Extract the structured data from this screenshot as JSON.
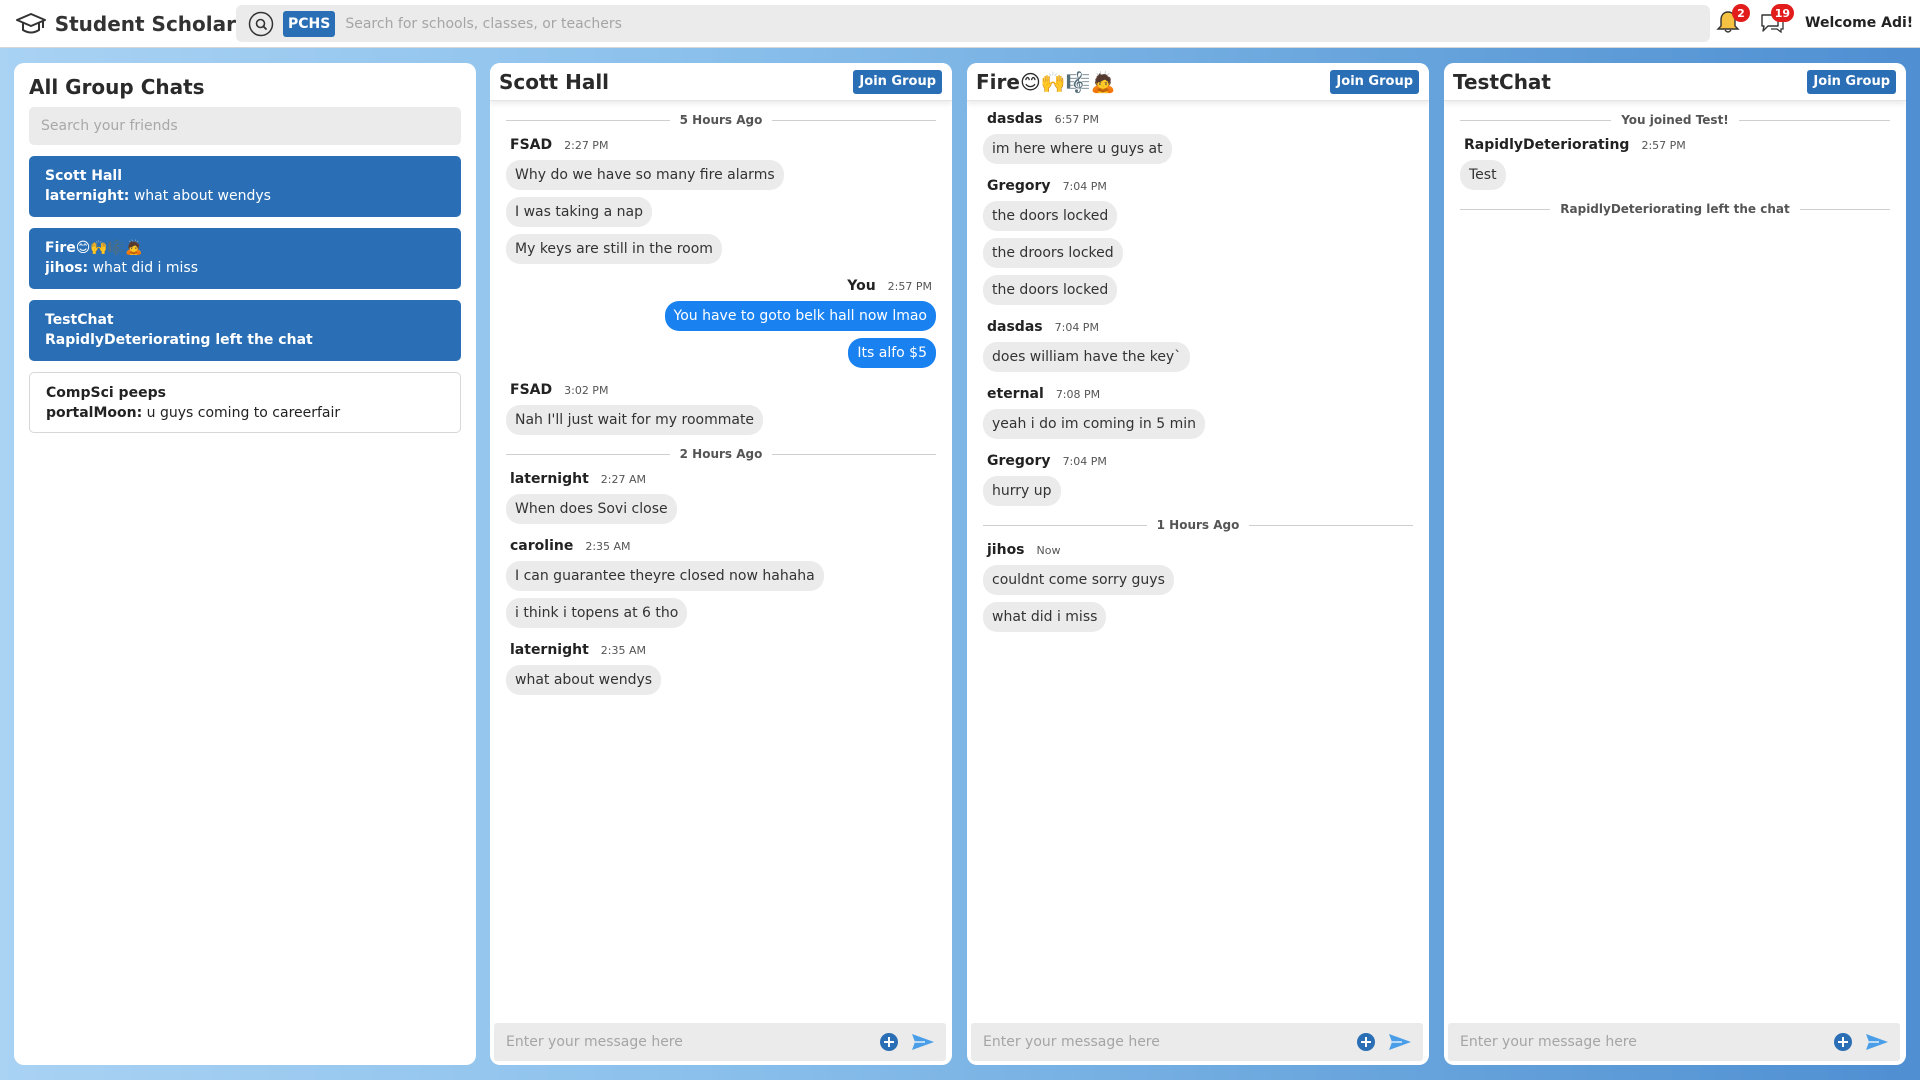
{
  "app": {
    "name": "Student Scholar",
    "search_placeholder": "Search for schools, classes, or teachers",
    "school_badge": "PCHS",
    "notifications_count": "2",
    "messages_count": "19",
    "welcome": "Welcome Adi!"
  },
  "sidebar": {
    "title": "All Group Chats",
    "search_placeholder": "Search your friends",
    "chats": [
      {
        "title": "Scott Hall",
        "sender": "laternight:",
        "preview": " what about wendys",
        "active": true
      },
      {
        "title": "Fire😊🙌🎼🙇",
        "sender": "jihos:",
        "preview": " what did i miss",
        "active": true
      },
      {
        "title": "TestChat",
        "sender": "",
        "preview": "RapidlyDeteriorating left the chat",
        "active": true
      },
      {
        "title": "CompSci peeps",
        "sender": "portalMoon:",
        "preview": " u guys coming to careerfair",
        "active": false
      }
    ]
  },
  "panels": {
    "scott": {
      "title": "Scott Hall",
      "join": "Join Group",
      "composer": "Enter your message here",
      "div1": "5 Hours Ago",
      "div2": "2 Hours Ago",
      "m1_sender": "FSAD",
      "m1_time": "2:27 PM",
      "m1_b1": "Why do we have so many fire alarms",
      "m1_b2": "I was taking a nap",
      "m1_b3": "My keys are still in the room",
      "m2_sender": "You",
      "m2_time": "2:57 PM",
      "m2_b1": "You have to goto belk hall now lmao",
      "m2_b2": "Its alfo $5",
      "m3_sender": "FSAD",
      "m3_time": "3:02 PM",
      "m3_b1": "Nah I'll just wait for my roommate",
      "m4_sender": "laternight",
      "m4_time": "2:27 AM",
      "m4_b1": "When does Sovi close",
      "m5_sender": "caroline",
      "m5_time": "2:35 AM",
      "m5_b1": "I can guarantee theyre closed now hahaha",
      "m5_b2": "i think i topens at 6 tho",
      "m6_sender": "laternight",
      "m6_time": "2:35 AM",
      "m6_b1": "what about wendys"
    },
    "fire": {
      "title": "Fire😊🙌🎼🙇",
      "join": "Join Group",
      "composer": "Enter your message here",
      "div1": "1 Hours Ago",
      "m1_sender": "dasdas",
      "m1_time": "6:57 PM",
      "m1_b1": "im here where u guys at",
      "m2_sender": "Gregory",
      "m2_time": "7:04 PM",
      "m2_b1": "the doors locked",
      "m2_b2": "the droors locked",
      "m2_b3": "the doors locked",
      "m3_sender": "dasdas",
      "m3_time": "7:04 PM",
      "m3_b1": "does william have the key`",
      "m4_sender": "eternal",
      "m4_time": "7:08 PM",
      "m4_b1": "yeah i do im coming in 5 min",
      "m5_sender": "Gregory",
      "m5_time": "7:04 PM",
      "m5_b1": "hurry up",
      "m6_sender": "jihos",
      "m6_time": "Now",
      "m6_b1": "couldnt come sorry guys",
      "m6_b2": "what did i miss"
    },
    "test": {
      "title": "TestChat",
      "join": "Join Group",
      "composer": "Enter your message here",
      "div1": "You joined Test!",
      "div2": "RapidlyDeteriorating left the chat",
      "m1_sender": "RapidlyDeteriorating",
      "m1_time": "2:57 PM",
      "m1_b1": "Test"
    }
  },
  "colors": {
    "accent": "#2a6fb5",
    "my_bubble": "#1a82f0",
    "bubble": "#ebebeb",
    "badge": "#e21b1b"
  }
}
